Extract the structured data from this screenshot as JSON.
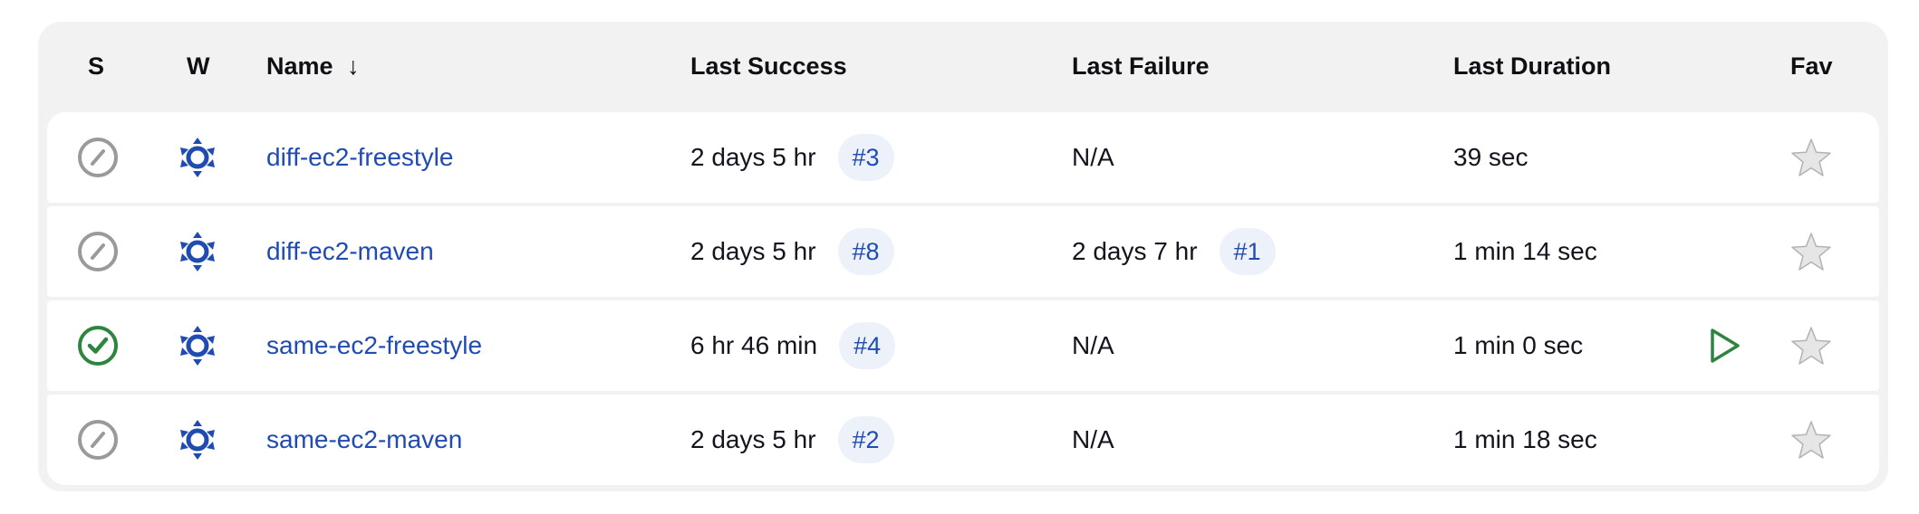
{
  "columns": {
    "status": "S",
    "weather": "W",
    "name": "Name",
    "name_sort_indicator": "↓",
    "last_success": "Last Success",
    "last_failure": "Last Failure",
    "last_duration": "Last Duration",
    "fav": "Fav"
  },
  "colors": {
    "link": "#1f4bb3",
    "success": "#2e8540",
    "disabled": "#9a9a9a",
    "badge_bg": "#edf1fa"
  },
  "jobs": [
    {
      "status_icon": "disabled-status-icon",
      "weather_icon": "sunny-weather-icon",
      "name": "diff-ec2-freestyle",
      "last_success": "2 days 5 hr",
      "last_success_build": "#3",
      "last_failure": "N/A",
      "last_failure_build": "",
      "last_duration": "39 sec",
      "run_button": false
    },
    {
      "status_icon": "disabled-status-icon",
      "weather_icon": "sunny-weather-icon",
      "name": "diff-ec2-maven",
      "last_success": "2 days 5 hr",
      "last_success_build": "#8",
      "last_failure": "2 days 7 hr",
      "last_failure_build": "#1",
      "last_duration": "1 min 14 sec",
      "run_button": false
    },
    {
      "status_icon": "success-status-icon",
      "weather_icon": "sunny-weather-icon",
      "name": "same-ec2-freestyle",
      "last_success": "6 hr 46 min",
      "last_success_build": "#4",
      "last_failure": "N/A",
      "last_failure_build": "",
      "last_duration": "1 min 0 sec",
      "run_button": true
    },
    {
      "status_icon": "disabled-status-icon",
      "weather_icon": "sunny-weather-icon",
      "name": "same-ec2-maven",
      "last_success": "2 days 5 hr",
      "last_success_build": "#2",
      "last_failure": "N/A",
      "last_failure_build": "",
      "last_duration": "1 min 18 sec",
      "run_button": false
    }
  ]
}
